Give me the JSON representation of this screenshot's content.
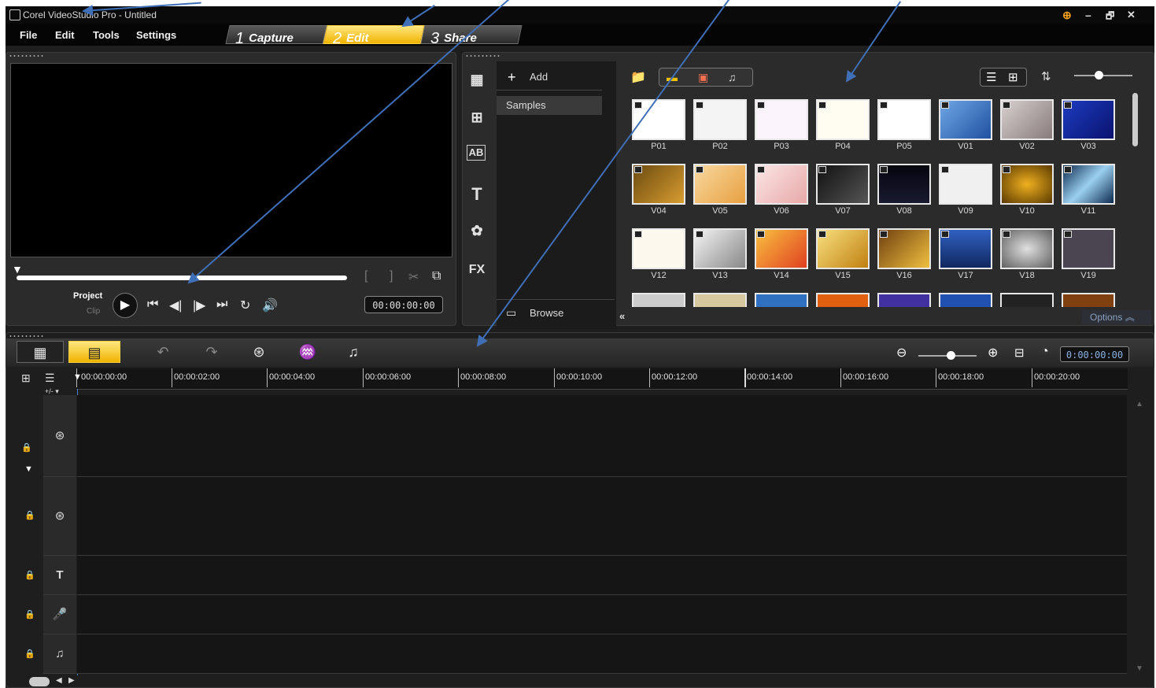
{
  "window": {
    "title": "Corel VideoStudio Pro - Untitled",
    "min": "–",
    "max": "🗗",
    "close": "✕"
  },
  "menu": {
    "file": "File",
    "edit": "Edit",
    "tools": "Tools",
    "settings": "Settings"
  },
  "steps": [
    {
      "num": "1",
      "label": "Capture"
    },
    {
      "num": "2",
      "label": "Edit"
    },
    {
      "num": "3",
      "label": "Share"
    }
  ],
  "player": {
    "project_label": "Project",
    "clip_label": "Clip",
    "timecode": "00:00:00:00",
    "mark_in": "[",
    "mark_out": "]"
  },
  "library": {
    "add_label": "Add",
    "folder": "Samples",
    "browse_label": "Browse",
    "options_label": "Options",
    "thumbnails": [
      "P01",
      "P02",
      "P03",
      "P04",
      "P05",
      "V01",
      "V02",
      "V03",
      "V04",
      "V05",
      "V06",
      "V07",
      "V08",
      "V09",
      "V10",
      "V11",
      "V12",
      "V13",
      "V14",
      "V15",
      "V16",
      "V17",
      "V18",
      "V19"
    ]
  },
  "timeline": {
    "duration": "0:00:00:00",
    "ruler": [
      "00:00:00:00",
      "00:00:02:00",
      "00:00:04:00",
      "00:00:06:00",
      "00:00:08:00",
      "00:00:10:00",
      "00:00:12:00",
      "00:00:14:00",
      "00:00:16:00",
      "00:00:18:00",
      "00:00:20:00"
    ],
    "add_track": "+/- ▾",
    "tracks": [
      "video-track",
      "overlay-track",
      "title-track",
      "voice-track",
      "music-track"
    ]
  },
  "colors": {
    "accent": "#f0b400",
    "annotation_arrow": "#3f6fb6"
  }
}
